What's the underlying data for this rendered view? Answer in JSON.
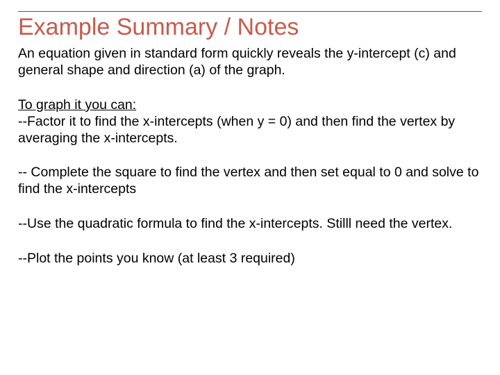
{
  "title": "Example Summary / Notes",
  "intro": "An equation given in standard form quickly reveals the y-intercept (c) and general shape and direction (a) of the graph.",
  "subhead": "To graph it you can:",
  "point1": "--Factor it to find the x-intercepts (when y = 0) and then find the vertex by averaging the x-intercepts.",
  "point2": "-- Complete the square to find the vertex and then set equal to 0 and solve to find the x-intercepts",
  "point3": "--Use the quadratic formula to find the x-intercepts. Stilll need the vertex.",
  "point4": "--Plot the points you know (at least 3 required)"
}
